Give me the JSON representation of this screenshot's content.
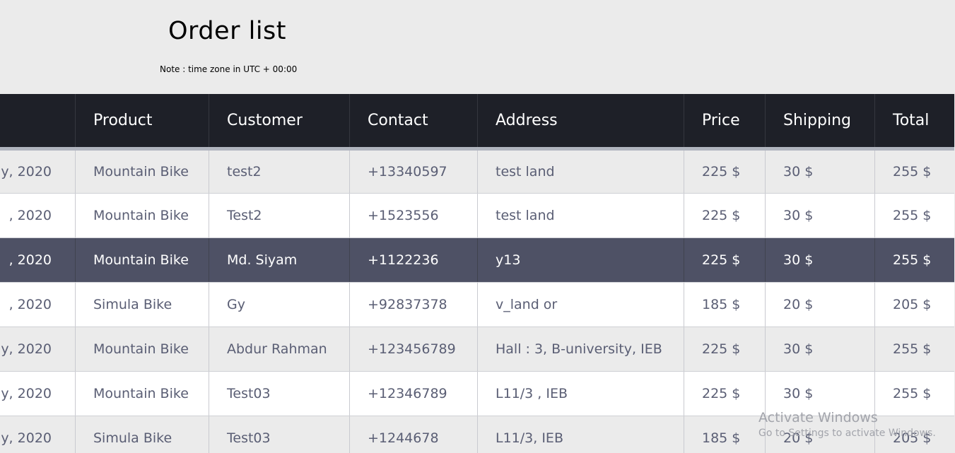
{
  "page": {
    "title": "Order list",
    "note": "Note : time zone in UTC + 00:00"
  },
  "table": {
    "headers": [
      "",
      "Product",
      "Customer",
      "Contact",
      "Address",
      "Price",
      "Shipping",
      "Total"
    ],
    "rows": [
      {
        "date": "y, 2020",
        "product": "Mountain Bike",
        "customer": "test2",
        "contact": "+13340597",
        "address": "test land",
        "price": "225 $",
        "shipping": "30 $",
        "total": "255 $"
      },
      {
        "date": ", 2020",
        "product": "Mountain Bike",
        "customer": "Test2",
        "contact": "+1523556",
        "address": "test land",
        "price": "225 $",
        "shipping": "30 $",
        "total": "255 $"
      },
      {
        "date": ", 2020",
        "product": "Mountain Bike",
        "customer": "Md. Siyam",
        "contact": "+1122236",
        "address": "y13",
        "price": "225 $",
        "shipping": "30 $",
        "total": "255 $"
      },
      {
        "date": ", 2020",
        "product": "Simula Bike",
        "customer": "Gy",
        "contact": "+92837378",
        "address": "v_land or",
        "price": "185 $",
        "shipping": "20 $",
        "total": "205 $"
      },
      {
        "date": "y, 2020",
        "product": "Mountain Bike",
        "customer": "Abdur Rahman",
        "contact": "+123456789",
        "address": "Hall : 3, B-university, IEB",
        "price": "225 $",
        "shipping": "30 $",
        "total": "255 $"
      },
      {
        "date": "y, 2020",
        "product": "Mountain Bike",
        "customer": "Test03",
        "contact": "+12346789",
        "address": "L11/3 , IEB",
        "price": "225 $",
        "shipping": "30 $",
        "total": "255 $"
      },
      {
        "date": "y, 2020",
        "product": "Simula Bike",
        "customer": "Test03",
        "contact": "+1244678",
        "address": "L11/3, IEB",
        "price": "185 $",
        "shipping": "20 $",
        "total": "205 $"
      }
    ],
    "highlighted_row": 2
  },
  "watermark": {
    "title": "Activate Windows",
    "subtitle": "Go to Settings to activate Windows."
  },
  "colors": {
    "header_bg": "#1e2028",
    "highlight_row_bg": "#4e5165",
    "cell_text": "#5a5e74",
    "page_bg": "#ebebeb"
  }
}
